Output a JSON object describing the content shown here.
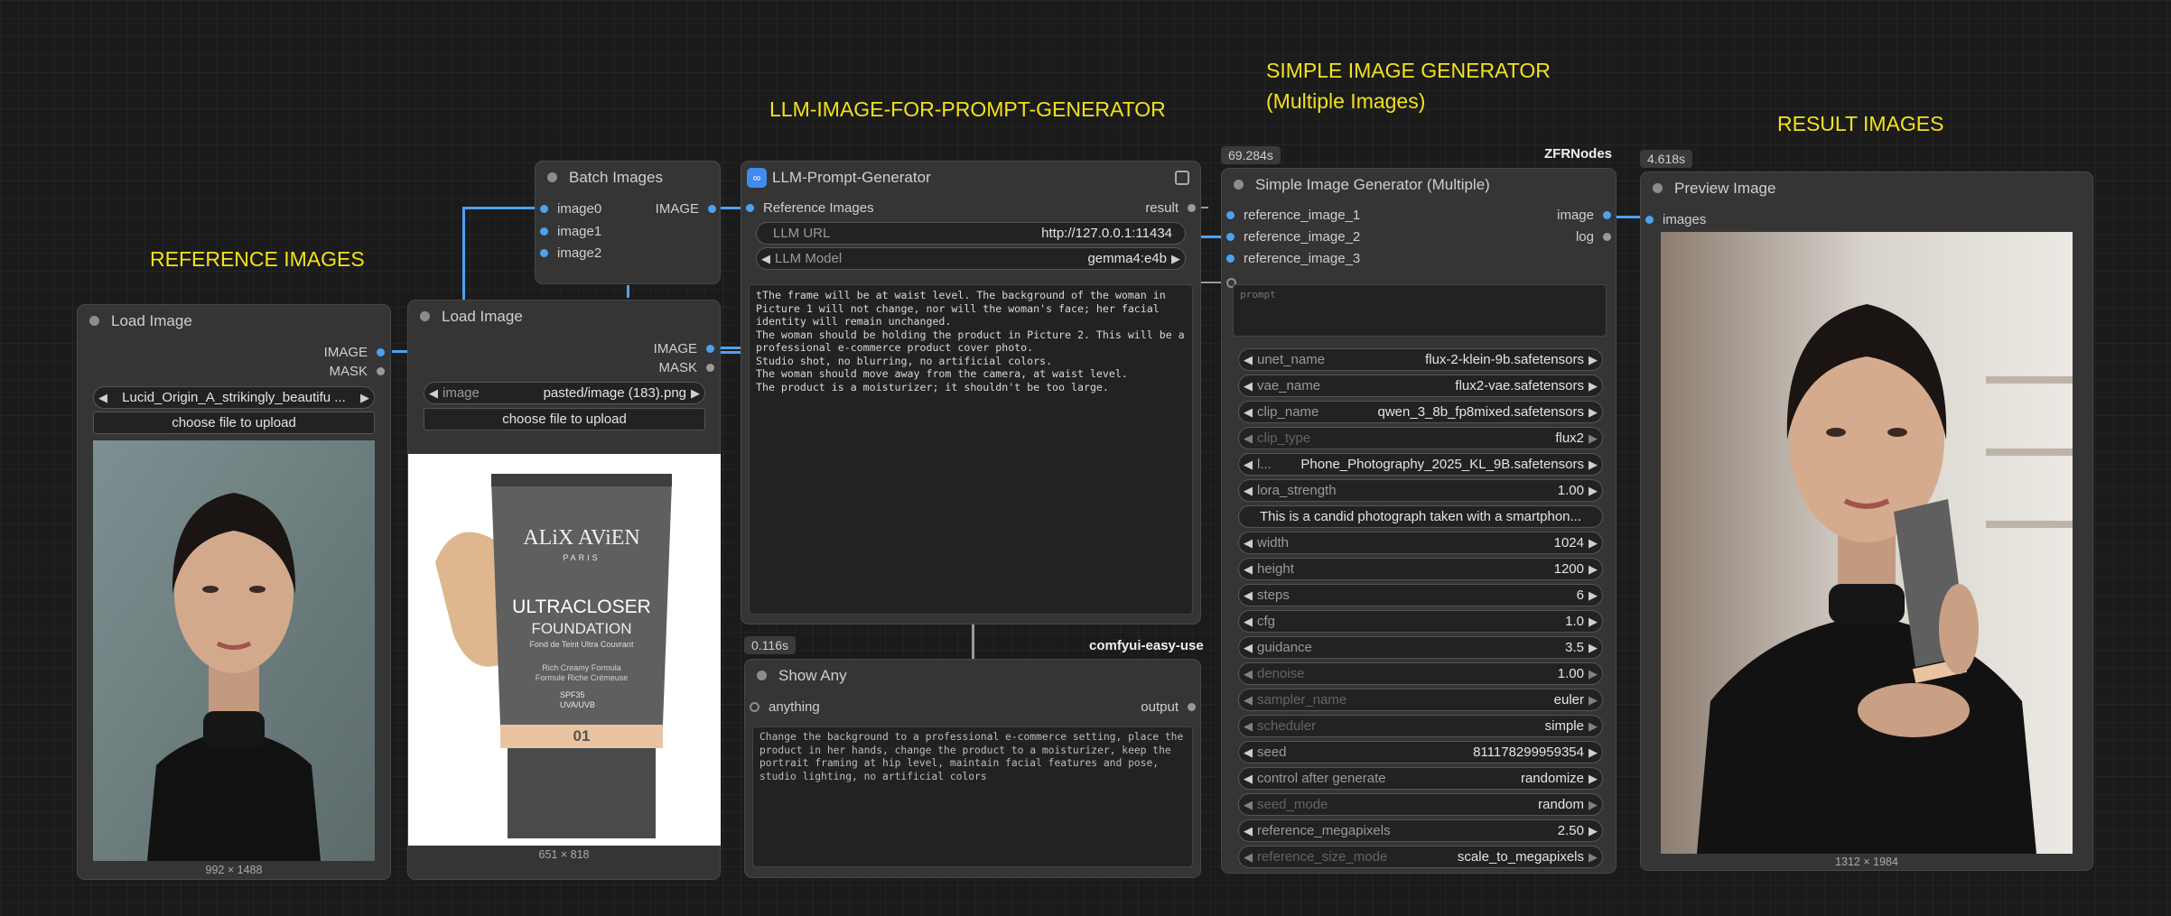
{
  "groups": {
    "reference": "REFERENCE IMAGES",
    "llm": "LLM-IMAGE-FOR-PROMPT-GENERATOR",
    "simple_line1": "SIMPLE IMAGE GENERATOR",
    "simple_line2": "(Multiple Images)",
    "result": "RESULT IMAGES"
  },
  "load_image_1": {
    "title": "Load Image",
    "out_image": "IMAGE",
    "out_mask": "MASK",
    "file_value": "Lucid_Origin_A_strikingly_beautifu ...",
    "upload_label": "choose file to upload",
    "dims": "992 × 1488"
  },
  "load_image_2": {
    "title": "Load Image",
    "out_image": "IMAGE",
    "out_mask": "MASK",
    "file_label": "image",
    "file_value": "pasted/image (183).png",
    "upload_label": "choose file to upload",
    "dims": "651 × 818",
    "product": {
      "brand": "ALiX AViEN",
      "city": "PARIS",
      "line1": "ULTRACLOSER",
      "line2": "FOUNDATION",
      "line3": "Fond de Teint Ultra Couvrant",
      "line4": "Rich Creamy Formula",
      "line5": "Formule Riche Crémeuse",
      "spf": "SPF35",
      "spf2": "UVA/UVB",
      "shade": "01"
    }
  },
  "batch": {
    "title": "Batch Images",
    "inputs": [
      "image0",
      "image1",
      "image2"
    ],
    "output": "IMAGE"
  },
  "llm_node": {
    "title": "LLM-Prompt-Generator",
    "input": "Reference Images",
    "output": "result",
    "url_label": "LLM URL",
    "url_value": "http://127.0.0.1:11434",
    "model_label": "LLM Model",
    "model_value": "gemma4:e4b",
    "prompt": "tThe frame will be at waist level. The background of the woman in\nPicture 1 will not change, nor will the woman's face; her facial\nidentity will remain unchanged.\nThe woman should be holding the product in Picture 2. This will be a\nprofessional e-commerce product cover photo.\nStudio shot, no blurring, no artificial colors.\nThe woman should move away from the camera, at waist level.\nThe product is a moisturizer; it shouldn't be too large."
  },
  "show_any": {
    "badge": "0.116s",
    "pack": "comfyui-easy-use",
    "title": "Show Any",
    "input": "anything",
    "output": "output",
    "text": "Change the background to a professional e-commerce setting, place the\nproduct in her hands, change the product to a moisturizer, keep the\nportrait framing at hip level, maintain facial features and pose,\nstudio lighting, no artificial colors"
  },
  "simple_gen": {
    "badge": "69.284s",
    "pack": "ZFRNodes",
    "title": "Simple Image Generator (Multiple)",
    "inputs": [
      "reference_image_1",
      "reference_image_2",
      "reference_image_3"
    ],
    "out_image": "image",
    "out_log": "log",
    "prompt_placeholder": "prompt",
    "widgets": [
      {
        "name": "unet_name",
        "value": "flux-2-klein-9b.safetensors"
      },
      {
        "name": "vae_name",
        "value": "flux2-vae.safetensors"
      },
      {
        "name": "clip_name",
        "value": "qwen_3_8b_fp8mixed.safetensors"
      },
      {
        "name": "clip_type",
        "value": "flux2"
      },
      {
        "name": "l...",
        "value": "Phone_Photography_2025_KL_9B.safetensors"
      },
      {
        "name": "lora_strength",
        "value": "1.00"
      },
      {
        "name": "",
        "value": "This is a candid photograph taken with a smartphon..."
      },
      {
        "name": "width",
        "value": "1024"
      },
      {
        "name": "height",
        "value": "1200"
      },
      {
        "name": "steps",
        "value": "6"
      },
      {
        "name": "cfg",
        "value": "1.0"
      },
      {
        "name": "guidance",
        "value": "3.5"
      },
      {
        "name": "denoise",
        "value": "1.00"
      },
      {
        "name": "sampler_name",
        "value": "euler"
      },
      {
        "name": "scheduler",
        "value": "simple"
      },
      {
        "name": "seed",
        "value": "811178299959354"
      },
      {
        "name": "control after generate",
        "value": "randomize"
      },
      {
        "name": "seed_mode",
        "value": "random"
      },
      {
        "name": "reference_megapixels",
        "value": "2.50"
      },
      {
        "name": "reference_size_mode",
        "value": "scale_to_megapixels"
      }
    ]
  },
  "preview": {
    "badge": "4.618s",
    "title": "Preview Image",
    "input": "images",
    "dims": "1312 × 1984"
  },
  "colors": {
    "link": "#4ba3f0",
    "group_title": "#f2e21c",
    "node_bg": "#353535"
  }
}
